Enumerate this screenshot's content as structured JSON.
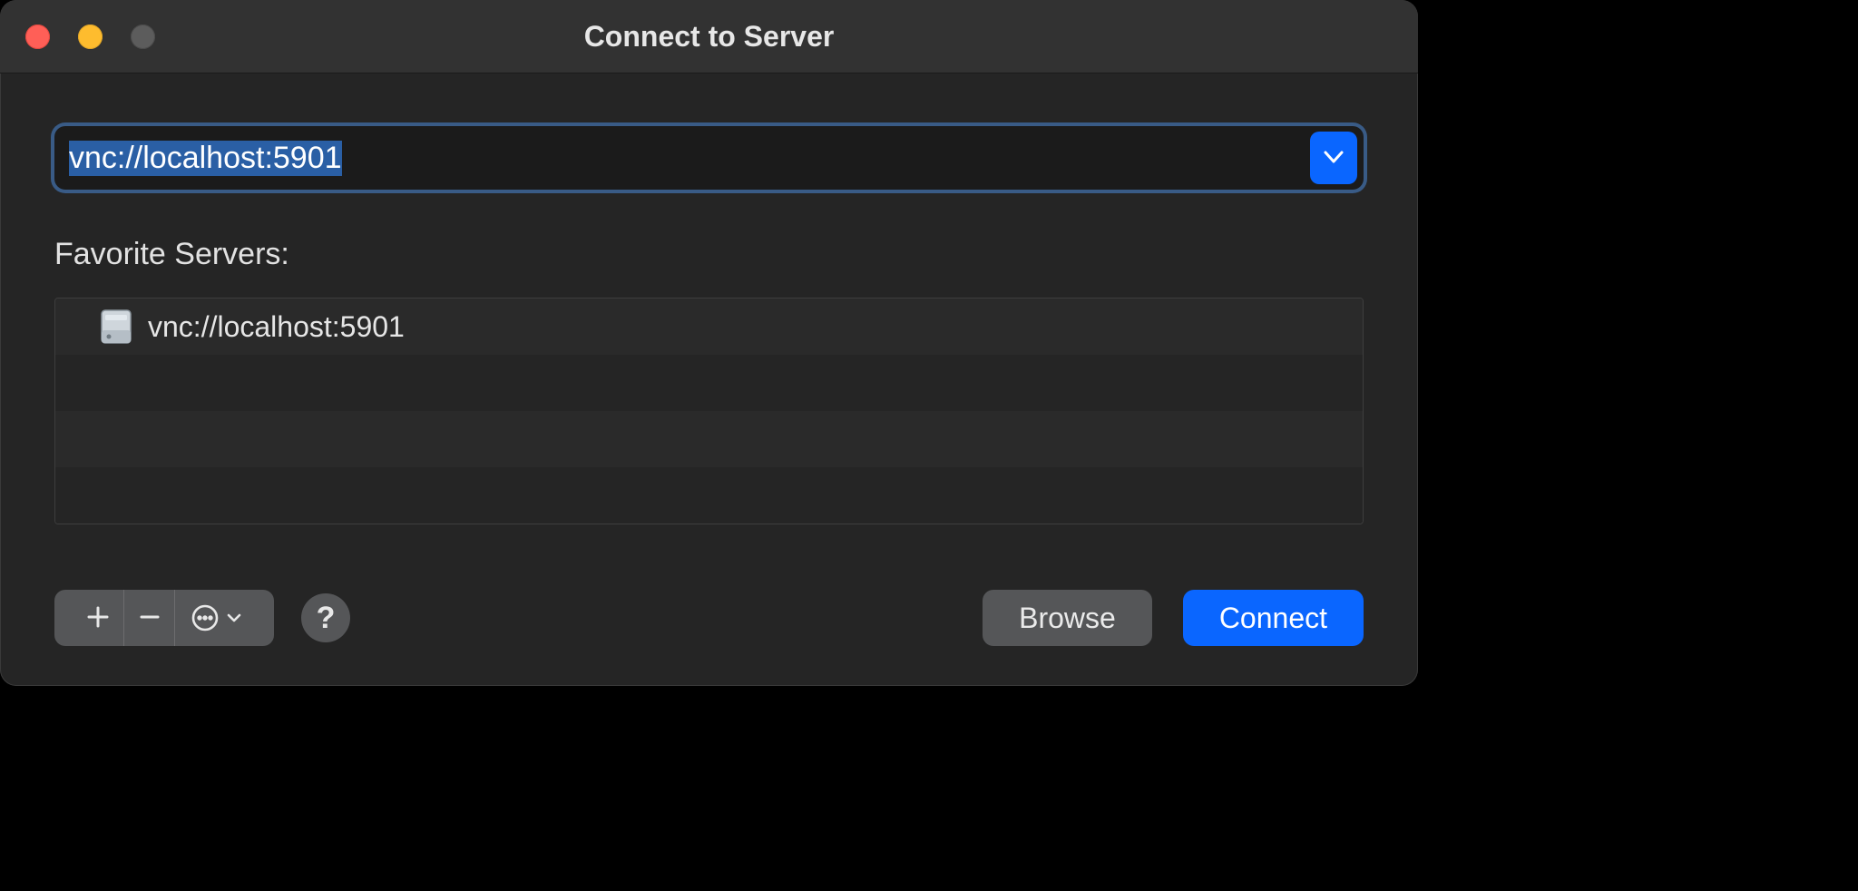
{
  "window": {
    "title": "Connect to Server"
  },
  "address": {
    "value": "vnc://localhost:5901"
  },
  "favorites": {
    "label": "Favorite Servers:",
    "items": [
      {
        "url": "vnc://localhost:5901"
      }
    ]
  },
  "actions": {
    "browse": "Browse",
    "connect": "Connect"
  }
}
